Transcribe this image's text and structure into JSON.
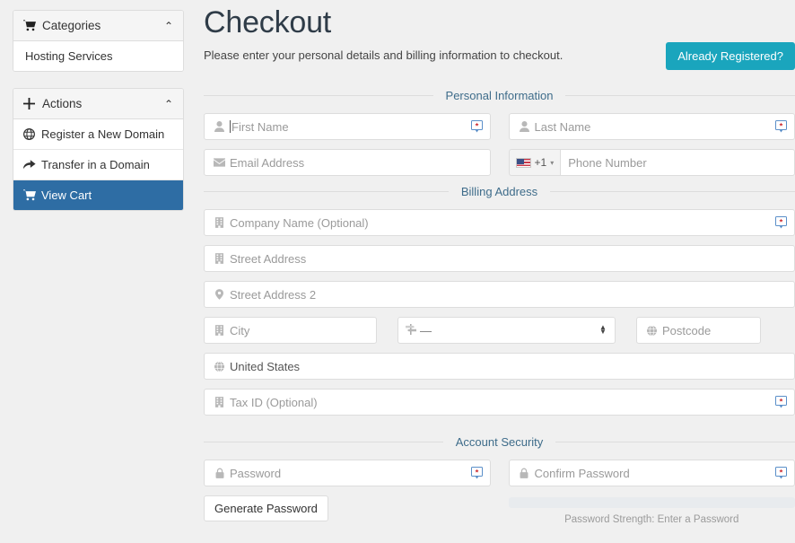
{
  "sidebar": {
    "panels": [
      {
        "title": "Categories",
        "icon": "cart-icon",
        "caret": "⌃",
        "items": [
          {
            "label": "Hosting Services",
            "icon": "",
            "active": false
          }
        ]
      },
      {
        "title": "Actions",
        "icon": "plus-icon",
        "caret": "⌃",
        "items": [
          {
            "label": "Register a New Domain",
            "icon": "globe-icon",
            "active": false
          },
          {
            "label": "Transfer in a Domain",
            "icon": "transfer-icon",
            "active": false
          },
          {
            "label": "View Cart",
            "icon": "cart-icon",
            "active": true
          }
        ]
      }
    ]
  },
  "main": {
    "title": "Checkout",
    "subtitle": "Please enter your personal details and billing information to checkout.",
    "already_registered_label": "Already Registered?",
    "sections": {
      "personal": "Personal Information",
      "billing": "Billing Address",
      "security": "Account Security"
    },
    "fields": {
      "first_name": "First Name",
      "last_name": "Last Name",
      "email": "Email Address",
      "phone": "Phone Number",
      "phone_code": "+1",
      "company": "Company Name (Optional)",
      "street1": "Street Address",
      "street2": "Street Address 2",
      "city": "City",
      "state": "—",
      "postcode": "Postcode",
      "country": "United States",
      "tax_id": "Tax ID (Optional)",
      "password": "Password",
      "confirm_password": "Confirm Password"
    },
    "generate_password_label": "Generate Password",
    "password_strength_label": "Password Strength: Enter a Password",
    "password_strength_percent": 0
  },
  "colors": {
    "accent_teal": "#1aa5bd",
    "active_blue": "#2e6da4",
    "legend_text": "#3e6c8a",
    "page_bg": "#f0f0f0"
  }
}
